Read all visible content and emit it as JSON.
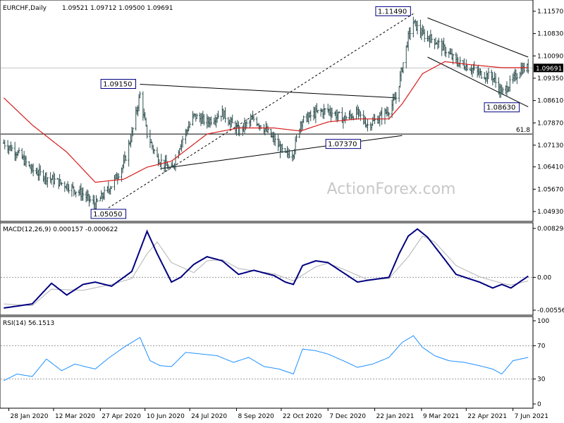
{
  "header": {
    "symbol": "EURCHF,Daily",
    "ohlc": "1.09521 1.09712 1.09500 1.09691"
  },
  "watermark": "ActionForex.com",
  "colors": {
    "bars": "#2f4f4f",
    "sma": "#d81b1b",
    "macd": "#000080",
    "signal": "#b3b3b3",
    "rsi": "#1e90ff",
    "price_tag_bg": "#000000",
    "price_tag_fg": "#ffffff"
  },
  "chart_data": [
    {
      "type": "bar",
      "title": "EURCHF,Daily",
      "ohlc_last": [
        1.09521,
        1.09712,
        1.095,
        1.09691
      ],
      "ylim": [
        1.0465,
        1.1185
      ],
      "ytick_labels": [
        "1.11570",
        "1.10830",
        "1.10090",
        "1.09350",
        "1.08610",
        "1.07870",
        "1.07130",
        "1.06410",
        "1.05670",
        "1.04930"
      ],
      "ytick_values": [
        1.1157,
        1.1083,
        1.1009,
        1.0935,
        1.0861,
        1.0787,
        1.0713,
        1.0641,
        1.0567,
        1.0493
      ],
      "current_price_label": "1.09691",
      "current_price": 1.09691,
      "x_labels": [
        "28 Jan 2020",
        "12 Mar 2020",
        "27 Apr 2020",
        "10 Jun 2020",
        "24 Jul 2020",
        "8 Sep 2020",
        "22 Oct 2020",
        "7 Dec 2020",
        "22 Jan 2021",
        "9 Mar 2021",
        "22 Apr 2021",
        "7 Jun 2021"
      ],
      "series": [
        {
          "kind": "close",
          "keypoints": [
            [
              "2020-01-23",
              1.072
            ],
            [
              "2020-02-05",
              1.069
            ],
            [
              "2020-02-20",
              1.063
            ],
            [
              "2020-03-10",
              1.06
            ],
            [
              "2020-03-25",
              1.058
            ],
            [
              "2020-04-10",
              1.055
            ],
            [
              "2020-04-22",
              1.0515
            ],
            [
              "2020-05-08",
              1.058
            ],
            [
              "2020-05-20",
              1.065
            ],
            [
              "2020-05-28",
              1.075
            ],
            [
              "2020-06-05",
              1.088
            ],
            [
              "2020-06-12",
              1.075
            ],
            [
              "2020-06-22",
              1.067
            ],
            [
              "2020-07-06",
              1.063
            ],
            [
              "2020-07-15",
              1.072
            ],
            [
              "2020-07-28",
              1.081
            ],
            [
              "2020-08-10",
              1.079
            ],
            [
              "2020-08-25",
              1.082
            ],
            [
              "2020-09-10",
              1.076
            ],
            [
              "2020-09-25",
              1.08
            ],
            [
              "2020-10-05",
              1.077
            ],
            [
              "2020-10-15",
              1.073
            ],
            [
              "2020-10-26",
              1.068
            ],
            [
              "2020-11-03",
              1.069
            ],
            [
              "2020-11-10",
              1.079
            ],
            [
              "2020-11-25",
              1.082
            ],
            [
              "2020-12-07",
              1.083
            ],
            [
              "2020-12-22",
              1.08
            ],
            [
              "2021-01-05",
              1.082
            ],
            [
              "2021-01-15",
              1.078
            ],
            [
              "2021-01-25",
              1.08
            ],
            [
              "2021-02-05",
              1.083
            ],
            [
              "2021-02-12",
              1.087
            ],
            [
              "2021-02-18",
              1.097
            ],
            [
              "2021-02-24",
              1.107
            ],
            [
              "2021-03-01",
              1.112
            ],
            [
              "2021-03-10",
              1.108
            ],
            [
              "2021-03-22",
              1.106
            ],
            [
              "2021-04-01",
              1.103
            ],
            [
              "2021-04-12",
              1.099
            ],
            [
              "2021-04-26",
              1.097
            ],
            [
              "2021-05-05",
              1.095
            ],
            [
              "2021-05-18",
              1.094
            ],
            [
              "2021-05-27",
              1.0885
            ],
            [
              "2021-06-05",
              1.092
            ],
            [
              "2021-06-15",
              1.0965
            ],
            [
              "2021-06-22",
              1.0969
            ]
          ]
        },
        {
          "kind": "sma55",
          "keypoints": [
            [
              "2020-01-23",
              1.087
            ],
            [
              "2020-02-20",
              1.078
            ],
            [
              "2020-03-25",
              1.069
            ],
            [
              "2020-04-22",
              1.059
            ],
            [
              "2020-05-20",
              1.06
            ],
            [
              "2020-06-12",
              1.064
            ],
            [
              "2020-07-06",
              1.066
            ],
            [
              "2020-08-10",
              1.075
            ],
            [
              "2020-09-10",
              1.077
            ],
            [
              "2020-10-15",
              1.077
            ],
            [
              "2020-11-10",
              1.076
            ],
            [
              "2020-12-07",
              1.079
            ],
            [
              "2021-01-05",
              1.08
            ],
            [
              "2021-02-05",
              1.08
            ],
            [
              "2021-02-18",
              1.085
            ],
            [
              "2021-03-10",
              1.095
            ],
            [
              "2021-04-01",
              1.099
            ],
            [
              "2021-04-26",
              1.098
            ],
            [
              "2021-05-27",
              1.097
            ],
            [
              "2021-06-22",
              1.097
            ]
          ]
        }
      ],
      "trendlines": [
        {
          "from": [
            "2020-05-05",
            1.0505
          ],
          "to": [
            "2021-03-01",
            1.1149
          ],
          "style": "dotted"
        },
        {
          "from": [
            "2020-06-05",
            1.0915
          ],
          "to": [
            "2021-02-12",
            1.087
          ],
          "style": "solid"
        },
        {
          "from": [
            "2020-06-25",
            1.0635
          ],
          "to": [
            "2021-02-18",
            1.0745
          ],
          "style": "solid"
        },
        {
          "from": [
            "2021-03-15",
            1.1135
          ],
          "to": [
            "2021-06-22",
            1.1005
          ],
          "style": "solid"
        },
        {
          "from": [
            "2021-03-15",
            1.1005
          ],
          "to": [
            "2021-06-22",
            1.084
          ],
          "style": "solid"
        }
      ],
      "horizontal_lines": [
        {
          "value": 1.0969,
          "style": "light"
        },
        {
          "value": 1.075,
          "label": "61.8",
          "style": "solid"
        }
      ],
      "annotations": [
        {
          "text": "1.11490",
          "value": 1.1149,
          "date": "2021-03-01"
        },
        {
          "text": "1.09150",
          "value": 1.0915,
          "date": "2020-06-05"
        },
        {
          "text": "1.07370",
          "value": 1.0737,
          "date": "2020-12-22"
        },
        {
          "text": "1.05050",
          "value": 1.0505,
          "date": "2020-05-05"
        },
        {
          "text": "1.08630",
          "value": 1.0863,
          "date": "2021-05-27"
        }
      ]
    },
    {
      "type": "line",
      "title": "MACD(12,26,9) 0.000157 -0.000622",
      "ytick_labels": [
        "0.008294",
        "0.00",
        "-0.005568"
      ],
      "ytick_values": [
        0.008294,
        0.0,
        -0.005568
      ],
      "zero_line_label": "0.00",
      "series": [
        {
          "kind": "macd",
          "keypoints": [
            [
              "2020-01-23",
              -0.0052
            ],
            [
              "2020-02-20",
              -0.0045
            ],
            [
              "2020-03-10",
              -0.001
            ],
            [
              "2020-03-25",
              -0.003
            ],
            [
              "2020-04-10",
              -0.0012
            ],
            [
              "2020-04-22",
              -0.0008
            ],
            [
              "2020-05-08",
              -0.0015
            ],
            [
              "2020-05-28",
              0.001
            ],
            [
              "2020-06-12",
              0.0078
            ],
            [
              "2020-06-22",
              0.004
            ],
            [
              "2020-07-06",
              -0.0008
            ],
            [
              "2020-07-15",
              0.0
            ],
            [
              "2020-07-28",
              0.0022
            ],
            [
              "2020-08-10",
              0.0035
            ],
            [
              "2020-08-25",
              0.0028
            ],
            [
              "2020-09-10",
              0.0005
            ],
            [
              "2020-09-25",
              0.0012
            ],
            [
              "2020-10-15",
              0.0003
            ],
            [
              "2020-10-26",
              -0.0008
            ],
            [
              "2020-11-03",
              -0.0012
            ],
            [
              "2020-11-12",
              0.002
            ],
            [
              "2020-11-25",
              0.0028
            ],
            [
              "2020-12-07",
              0.0025
            ],
            [
              "2020-12-22",
              0.0008
            ],
            [
              "2021-01-05",
              -0.0008
            ],
            [
              "2021-01-15",
              -0.0005
            ],
            [
              "2021-02-05",
              0.0
            ],
            [
              "2021-02-15",
              0.004
            ],
            [
              "2021-02-24",
              0.007
            ],
            [
              "2021-03-05",
              0.0082
            ],
            [
              "2021-03-15",
              0.0068
            ],
            [
              "2021-04-01",
              0.003
            ],
            [
              "2021-04-12",
              0.0005
            ],
            [
              "2021-05-05",
              -0.0008
            ],
            [
              "2021-05-18",
              -0.0018
            ],
            [
              "2021-05-27",
              -0.0012
            ],
            [
              "2021-06-05",
              -0.0018
            ],
            [
              "2021-06-22",
              0.0002
            ]
          ]
        },
        {
          "kind": "signal",
          "keypoints": [
            [
              "2020-01-23",
              -0.0045
            ],
            [
              "2020-02-20",
              -0.0048
            ],
            [
              "2020-03-10",
              -0.002
            ],
            [
              "2020-04-10",
              -0.0022
            ],
            [
              "2020-05-08",
              -0.0012
            ],
            [
              "2020-05-28",
              -0.0002
            ],
            [
              "2020-06-12",
              0.004
            ],
            [
              "2020-06-22",
              0.006
            ],
            [
              "2020-07-06",
              0.0025
            ],
            [
              "2020-07-28",
              0.0008
            ],
            [
              "2020-08-10",
              0.0028
            ],
            [
              "2020-08-25",
              0.003
            ],
            [
              "2020-09-10",
              0.0015
            ],
            [
              "2020-10-15",
              0.0006
            ],
            [
              "2020-11-03",
              -0.0006
            ],
            [
              "2020-11-25",
              0.0018
            ],
            [
              "2020-12-07",
              0.0024
            ],
            [
              "2020-12-22",
              0.0014
            ],
            [
              "2021-01-15",
              -0.0004
            ],
            [
              "2021-02-05",
              -0.0002
            ],
            [
              "2021-02-24",
              0.0035
            ],
            [
              "2021-03-10",
              0.007
            ],
            [
              "2021-03-22",
              0.006
            ],
            [
              "2021-04-12",
              0.002
            ],
            [
              "2021-05-05",
              0.0001
            ],
            [
              "2021-05-27",
              -0.001
            ],
            [
              "2021-06-05",
              -0.0013
            ],
            [
              "2021-06-22",
              -0.0006
            ]
          ]
        }
      ]
    },
    {
      "type": "line",
      "title": "RSI(14) 56.1513",
      "ylim": [
        0,
        100
      ],
      "ytick_labels": [
        "100",
        "70",
        "30",
        "0"
      ],
      "ytick_values": [
        100,
        70,
        30,
        0
      ],
      "reference_lines": [
        70,
        30
      ],
      "series": [
        {
          "kind": "rsi",
          "keypoints": [
            [
              "2020-01-23",
              28
            ],
            [
              "2020-02-05",
              36
            ],
            [
              "2020-02-20",
              33
            ],
            [
              "2020-03-05",
              54
            ],
            [
              "2020-03-20",
              40
            ],
            [
              "2020-04-02",
              48
            ],
            [
              "2020-04-15",
              44
            ],
            [
              "2020-04-22",
              42
            ],
            [
              "2020-05-05",
              55
            ],
            [
              "2020-05-20",
              68
            ],
            [
              "2020-06-05",
              80
            ],
            [
              "2020-06-15",
              52
            ],
            [
              "2020-06-25",
              46
            ],
            [
              "2020-07-06",
              45
            ],
            [
              "2020-07-20",
              62
            ],
            [
              "2020-08-05",
              60
            ],
            [
              "2020-08-20",
              58
            ],
            [
              "2020-09-05",
              50
            ],
            [
              "2020-09-20",
              56
            ],
            [
              "2020-10-05",
              45
            ],
            [
              "2020-10-20",
              42
            ],
            [
              "2020-11-03",
              36
            ],
            [
              "2020-11-12",
              66
            ],
            [
              "2020-11-25",
              64
            ],
            [
              "2020-12-07",
              60
            ],
            [
              "2020-12-22",
              52
            ],
            [
              "2021-01-05",
              44
            ],
            [
              "2021-01-20",
              48
            ],
            [
              "2021-02-05",
              56
            ],
            [
              "2021-02-18",
              74
            ],
            [
              "2021-03-01",
              82
            ],
            [
              "2021-03-10",
              68
            ],
            [
              "2021-03-22",
              58
            ],
            [
              "2021-04-05",
              52
            ],
            [
              "2021-04-20",
              50
            ],
            [
              "2021-05-05",
              46
            ],
            [
              "2021-05-18",
              42
            ],
            [
              "2021-05-27",
              36
            ],
            [
              "2021-06-07",
              52
            ],
            [
              "2021-06-22",
              56
            ]
          ]
        }
      ]
    }
  ]
}
